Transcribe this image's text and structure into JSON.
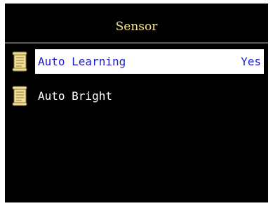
{
  "screen": {
    "title": "Sensor"
  },
  "menu": {
    "items": [
      {
        "label": "Auto Learning",
        "value": "Yes",
        "selected": true,
        "icon": "scroll-icon"
      },
      {
        "label": "Auto Bright",
        "value": "",
        "selected": false,
        "icon": "scroll-icon"
      }
    ]
  },
  "colors": {
    "background": "#000000",
    "title_text": "#f3e88a",
    "item_text": "#ffffff",
    "highlight_background": "#ffffff",
    "highlight_text": "#1f1fcf",
    "icon_fill": "#f2dc9a",
    "icon_stroke": "#8a7a3a",
    "separator": "#5a5a5a"
  }
}
